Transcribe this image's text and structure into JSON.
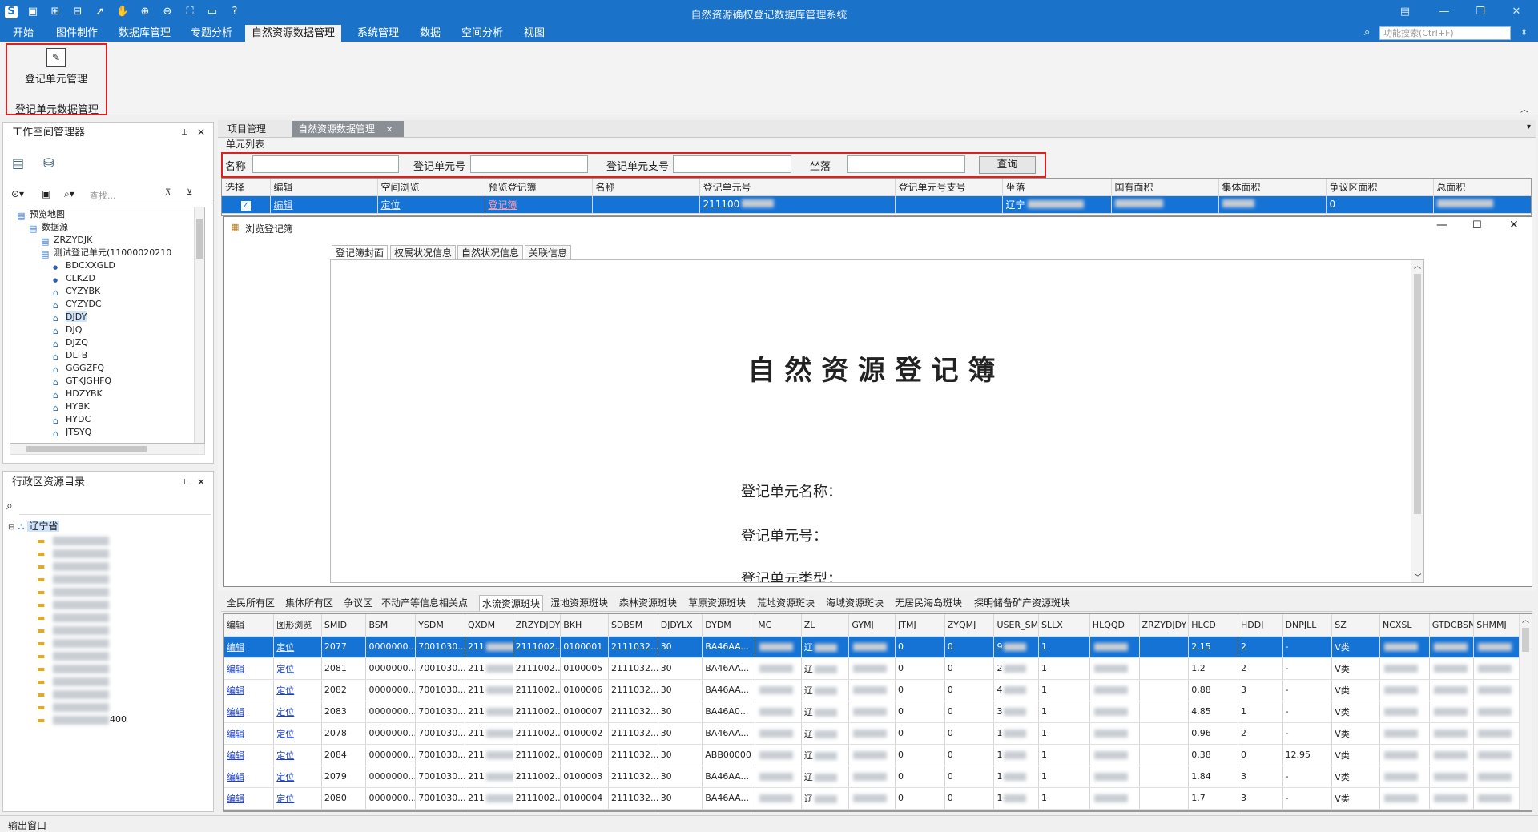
{
  "app": {
    "title": "自然资源确权登记数据库管理系统",
    "search_placeholder": "功能搜索(Ctrl+F)"
  },
  "menu": [
    "开始",
    "图件制作",
    "数据库管理",
    "专题分析",
    "自然资源数据管理",
    "系统管理",
    "数据",
    "空间分析",
    "视图"
  ],
  "ribbon": {
    "button": "登记单元管理",
    "group": "登记单元数据管理"
  },
  "workspace": {
    "title": "工作空间管理器",
    "search": "查找...",
    "tree": [
      {
        "label": "预览地图",
        "level": 0
      },
      {
        "label": "数据源",
        "level": 1
      },
      {
        "label": "ZRZYDJK",
        "level": 2
      },
      {
        "label": "测试登记单元(11000020210",
        "level": 2
      },
      {
        "label": "BDCXXGLD",
        "level": 3,
        "dot": true
      },
      {
        "label": "CLKZD",
        "level": 3,
        "dot": true
      },
      {
        "label": "CYZYBK",
        "level": 3
      },
      {
        "label": "CYZYDC",
        "level": 3
      },
      {
        "label": "DJDY",
        "level": 3,
        "selected": true
      },
      {
        "label": "DJQ",
        "level": 3
      },
      {
        "label": "DJZQ",
        "level": 3
      },
      {
        "label": "DLTB",
        "level": 3
      },
      {
        "label": "GGGZFQ",
        "level": 3
      },
      {
        "label": "GTKJGHFQ",
        "level": 3
      },
      {
        "label": "HDZYBK",
        "level": 3
      },
      {
        "label": "HYBK",
        "level": 3
      },
      {
        "label": "HYDC",
        "level": 3
      },
      {
        "label": "JTSYQ",
        "level": 3
      }
    ]
  },
  "admin": {
    "title": "行政区资源目录",
    "root": "辽宁省",
    "tail": "400"
  },
  "doctabs": [
    "项目管理",
    "自然资源数据管理"
  ],
  "unit_list": {
    "title": "单元列表",
    "name_label": "名称",
    "no_label": "登记单元号",
    "sub_label": "登记单元支号",
    "loc_label": "坐落",
    "query": "查询",
    "headers": [
      "选择",
      "编辑",
      "空间浏览",
      "预览登记簿",
      "名称",
      "登记单元号",
      "登记单元号支号",
      "坐落",
      "国有面积",
      "集体面积",
      "争议区面积",
      "总面积"
    ],
    "row": {
      "edit": "编辑",
      "locate": "定位",
      "preview": "登记簿",
      "no": "211100",
      "loc": "辽宁",
      "dispute": "0"
    }
  },
  "modal": {
    "title": "浏览登记簿",
    "tabs": [
      "登记簿封面",
      "权属状况信息",
      "自然状况信息",
      "关联信息"
    ],
    "heading": "自 然 资 源 登 记 簿",
    "lines": [
      "登记单元名称：",
      "登记单元号：",
      "登记单元类型："
    ]
  },
  "lower": {
    "tabs": [
      "全民所有区",
      "集体所有区",
      "争议区",
      "不动产等信息相关点",
      "水流资源斑块",
      "湿地资源斑块",
      "森林资源斑块",
      "草原资源斑块",
      "荒地资源斑块",
      "海域资源斑块",
      "无居民海岛斑块",
      "探明储备矿产资源斑块"
    ],
    "headers": [
      "编辑",
      "图形浏览",
      "SMID",
      "BSM",
      "YSDM",
      "QXDM",
      "ZRZYDJDY",
      "BKH",
      "SDBSM",
      "DJDYLX",
      "DYDM",
      "MC",
      "ZL",
      "GYMJ",
      "JTMJ",
      "ZYQMJ",
      "USER_SMI",
      "SLLX",
      "HLQQD",
      "ZRZYDJDY",
      "HLCD",
      "HDDJ",
      "DNPJLL",
      "SZ",
      "NCXSL",
      "GTDCBSM",
      "SHMMJ"
    ],
    "rows": [
      [
        "编辑",
        "定位",
        "2077",
        "0000000...",
        "7001030...",
        "211",
        "2111002...",
        "0100001",
        "2111032...",
        "30",
        "BA46AA...",
        "",
        "辽",
        "",
        "0",
        "0",
        "9",
        "1",
        "",
        "",
        "2.15",
        "2",
        "-",
        "V类",
        "",
        "",
        ""
      ],
      [
        "编辑",
        "定位",
        "2081",
        "0000000...",
        "7001030...",
        "211",
        "2111002...",
        "0100005",
        "2111032...",
        "30",
        "BA46AA...",
        "",
        "辽",
        "",
        "0",
        "0",
        "2",
        "1",
        "",
        "",
        "1.2",
        "2",
        "-",
        "V类",
        "",
        "",
        ""
      ],
      [
        "编辑",
        "定位",
        "2082",
        "0000000...",
        "7001030...",
        "211",
        "2111002...",
        "0100006",
        "2111032...",
        "30",
        "BA46AA...",
        "",
        "辽",
        "",
        "0",
        "0",
        "4",
        "1",
        "",
        "",
        "0.88",
        "3",
        "-",
        "V类",
        "",
        "",
        ""
      ],
      [
        "编辑",
        "定位",
        "2083",
        "0000000...",
        "7001030...",
        "211",
        "2111002...",
        "0100007",
        "2111032...",
        "30",
        "BA46A0...",
        "",
        "辽",
        "",
        "0",
        "0",
        "3",
        "1",
        "",
        "",
        "4.85",
        "1",
        "-",
        "V类",
        "",
        "",
        ""
      ],
      [
        "编辑",
        "定位",
        "2078",
        "0000000...",
        "7001030...",
        "211",
        "2111002...",
        "0100002",
        "2111032...",
        "30",
        "BA46AA...",
        "",
        "辽",
        "",
        "0",
        "0",
        "1",
        "1",
        "",
        "",
        "0.96",
        "2",
        "-",
        "V类",
        "",
        "",
        ""
      ],
      [
        "编辑",
        "定位",
        "2084",
        "0000000...",
        "7001030...",
        "211",
        "2111002...",
        "0100008",
        "2111032...",
        "30",
        "ABB00000",
        "",
        "辽",
        "",
        "0",
        "0",
        "1",
        "1",
        "",
        "",
        "0.38",
        "0",
        "12.95",
        "V类",
        "",
        "",
        ""
      ],
      [
        "编辑",
        "定位",
        "2079",
        "0000000...",
        "7001030...",
        "211",
        "2111002...",
        "0100003",
        "2111032...",
        "30",
        "BA46AA...",
        "",
        "辽",
        "",
        "0",
        "0",
        "1",
        "1",
        "",
        "",
        "1.84",
        "3",
        "-",
        "V类",
        "",
        "",
        ""
      ],
      [
        "编辑",
        "定位",
        "2080",
        "0000000...",
        "7001030...",
        "211",
        "2111002...",
        "0100004",
        "2111032...",
        "30",
        "BA46AA...",
        "",
        "辽",
        "",
        "0",
        "0",
        "1",
        "1",
        "",
        "",
        "1.7",
        "3",
        "-",
        "V类",
        "",
        "",
        ""
      ]
    ]
  },
  "status": "输出窗口"
}
